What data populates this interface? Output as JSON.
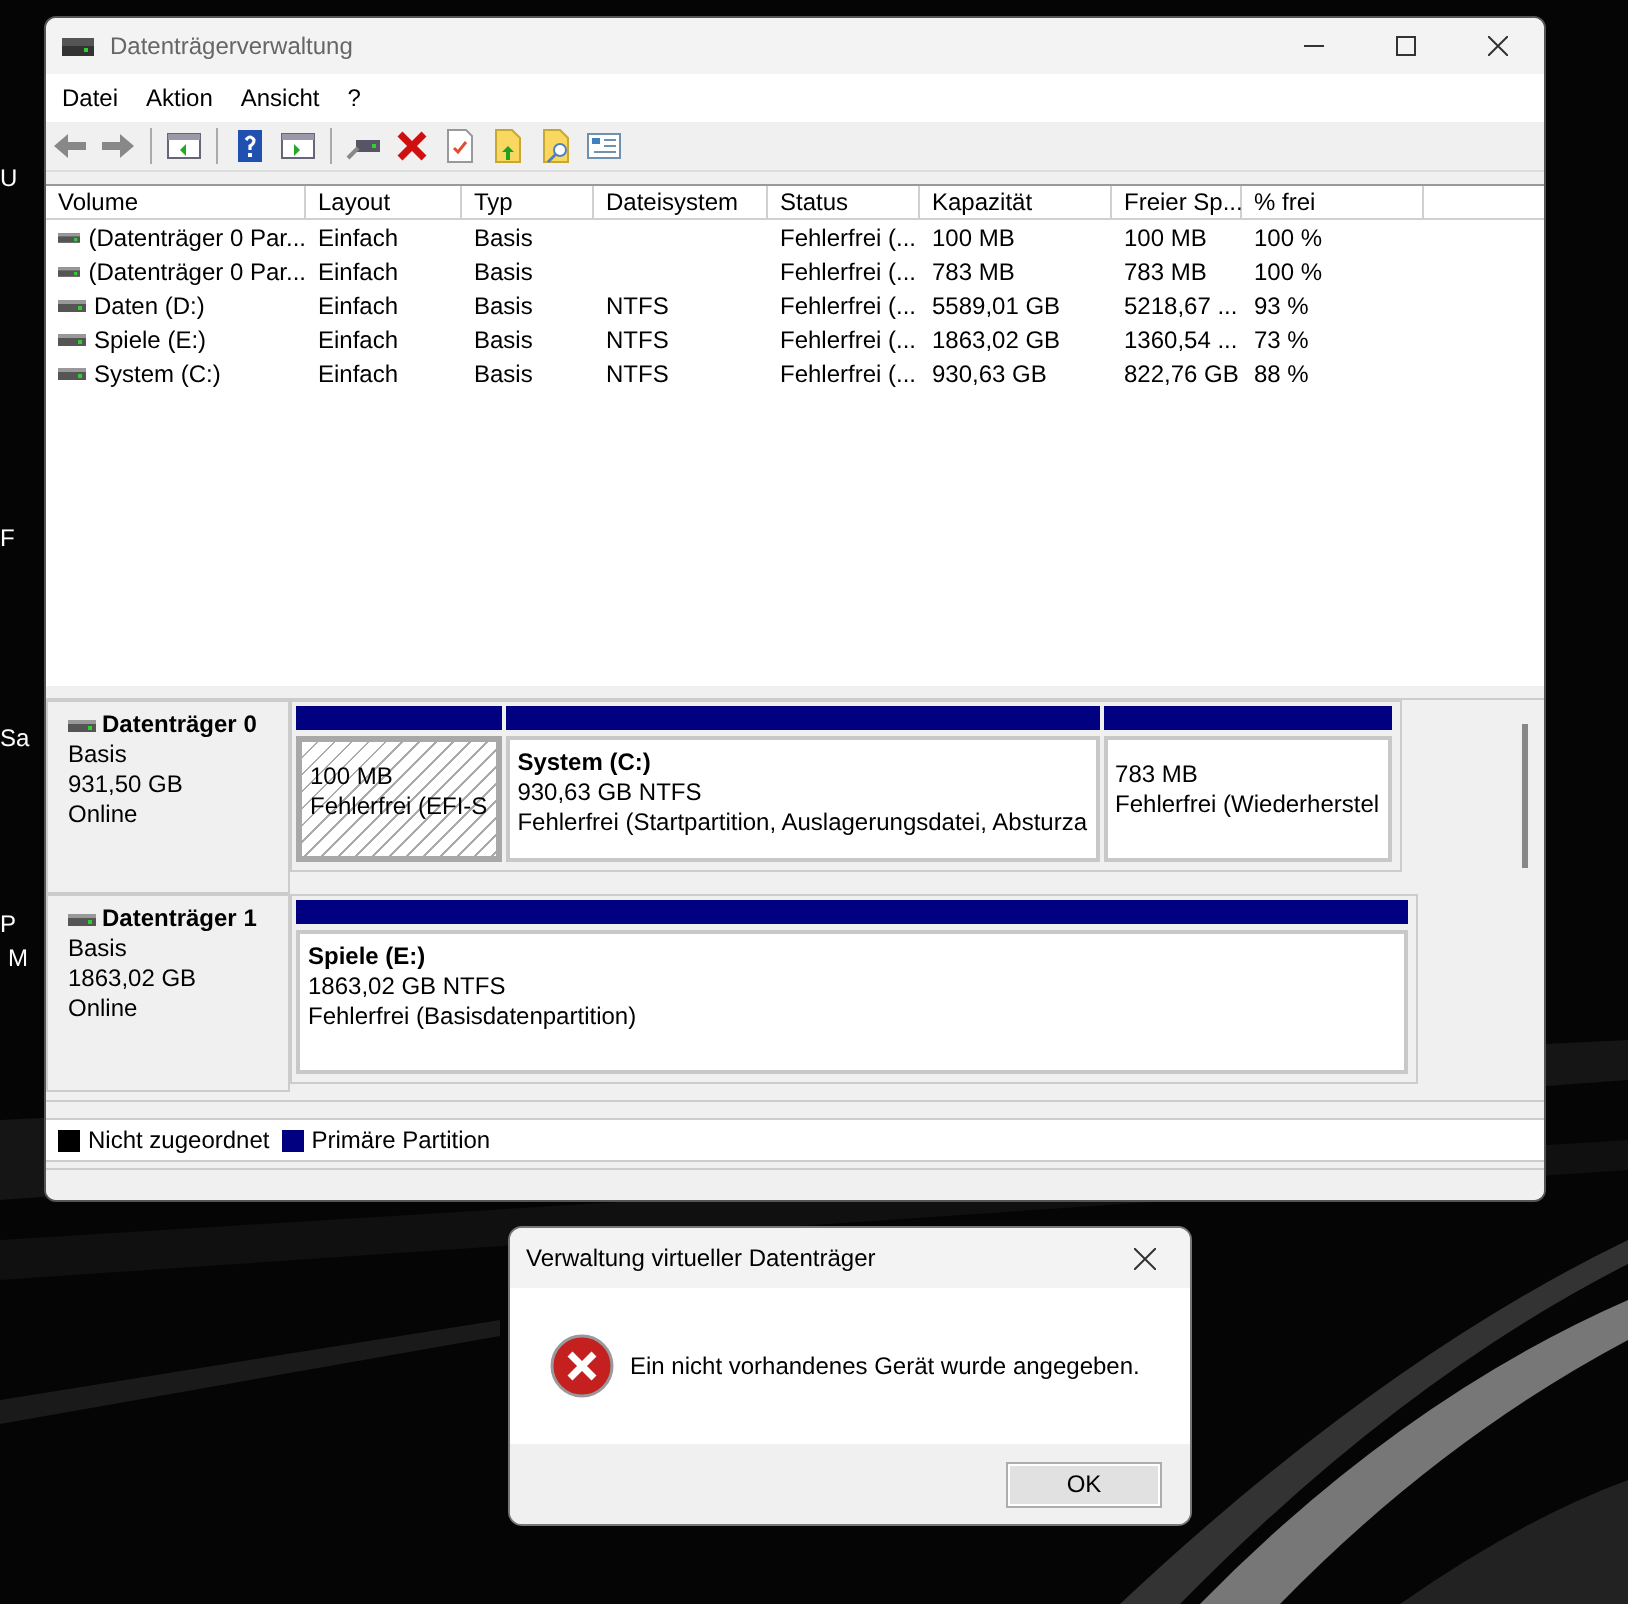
{
  "desktop_labels": [
    "U",
    "F",
    "Sa",
    "P",
    "M"
  ],
  "window": {
    "title": "Datenträgerverwaltung",
    "menu": [
      "Datei",
      "Aktion",
      "Ansicht",
      "?"
    ]
  },
  "volume_table": {
    "columns": [
      "Volume",
      "Layout",
      "Typ",
      "Dateisystem",
      "Status",
      "Kapazität",
      "Freier Sp...",
      "% frei"
    ],
    "rows": [
      [
        "(Datenträger 0 Par...",
        "Einfach",
        "Basis",
        null,
        "Fehlerfrei (...",
        "100 MB",
        "100 MB",
        "100 %"
      ],
      [
        "(Datenträger 0 Par...",
        "Einfach",
        "Basis",
        null,
        "Fehlerfrei (...",
        "783 MB",
        "783 MB",
        "100 %"
      ],
      [
        "Daten (D:)",
        "Einfach",
        "Basis",
        "NTFS",
        "Fehlerfrei (...",
        "5589,01 GB",
        "5218,67 ...",
        "93 %"
      ],
      [
        "Spiele (E:)",
        "Einfach",
        "Basis",
        "NTFS",
        "Fehlerfrei (...",
        "1863,02 GB",
        "1360,54 ...",
        "73 %"
      ],
      [
        "System (C:)",
        "Einfach",
        "Basis",
        "NTFS",
        "Fehlerfrei (...",
        "930,63 GB",
        "822,76 GB",
        "88 %"
      ]
    ]
  },
  "disks": [
    {
      "name": "Datenträger 0",
      "type": "Basis",
      "size": "931,50 GB",
      "status": "Online",
      "partitions": [
        {
          "size": "100 MB",
          "status": "Fehlerfrei (EFI-S",
          "selected": true,
          "color": "#000080"
        },
        {
          "label": "System  (C:)",
          "size": "930,63 GB NTFS",
          "status": "Fehlerfrei (Startpartition, Auslagerungsdatei, Absturza",
          "selected": false,
          "color": "#000080"
        },
        {
          "size": "783 MB",
          "status": "Fehlerfrei (Wiederherstel",
          "selected": false,
          "color": "#000080"
        }
      ]
    },
    {
      "name": "Datenträger 1",
      "type": "Basis",
      "size": "1863,02 GB",
      "status": "Online",
      "partitions": [
        {
          "label": "Spiele  (E:)",
          "size": "1863,02 GB NTFS",
          "status": "Fehlerfrei (Basisdatenpartition)",
          "selected": false,
          "color": "#000080"
        }
      ]
    }
  ],
  "legend": [
    {
      "label": "Nicht zugeordnet",
      "color": "#000000"
    },
    {
      "label": "Primäre Partition",
      "color": "#000080"
    }
  ],
  "dialog": {
    "title": "Verwaltung virtueller Datenträger",
    "message": "Ein nicht vorhandenes Gerät wurde angegeben.",
    "button": "OK"
  }
}
